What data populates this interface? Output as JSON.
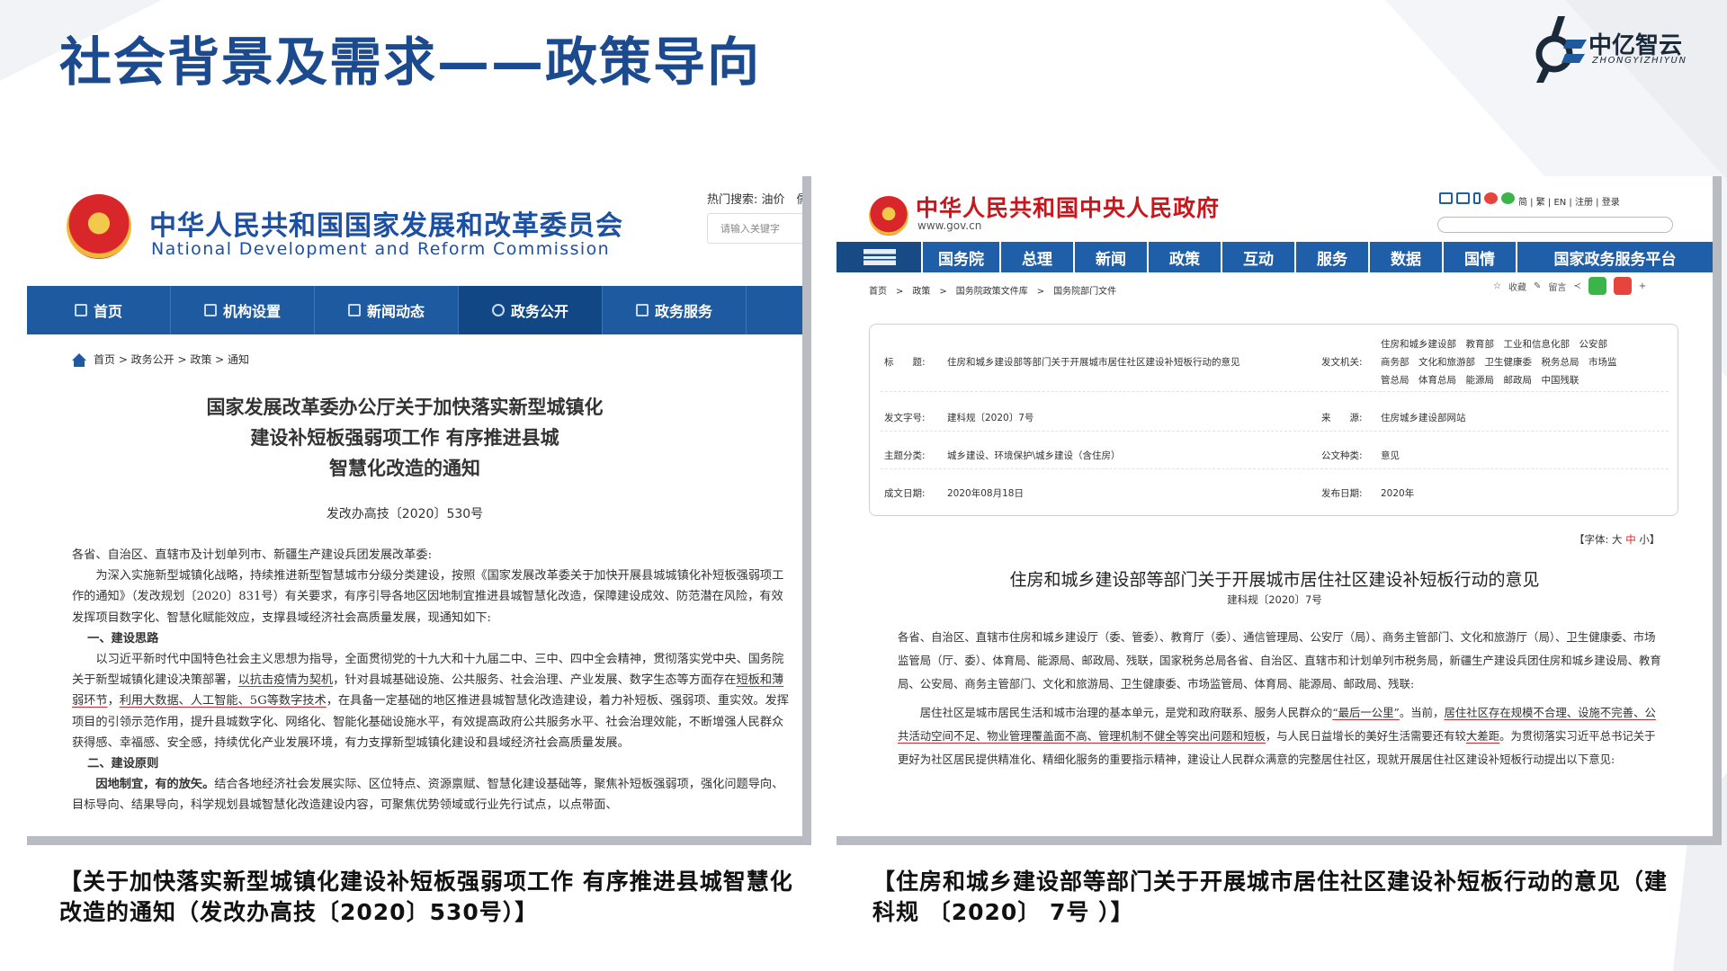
{
  "slide": {
    "title": "社会背景及需求——政策导向",
    "logo": {
      "cn": "中亿智云",
      "en": "ZHONGYIZHIYUN"
    }
  },
  "left_doc": {
    "site_name_cn": "中华人民共和国国家发展和改革委员会",
    "site_name_en": "National Development and Reform Commission",
    "hot_search": "热门搜索: 油价　儒",
    "search_placeholder": "请输入关键字",
    "nav": [
      "首页",
      "机构设置",
      "新闻动态",
      "政务公开",
      "政务服务"
    ],
    "breadcrumb": "首页 > 政务公开 > 政策 > 通知",
    "title_lines": [
      "国家发展改革委办公厅关于加快落实新型城镇化",
      "建设补短板强弱项工作 有序推进县城",
      "智慧化改造的通知"
    ],
    "doc_number": "发改办高技〔2020〕530号",
    "salutation": "各省、自治区、直辖市及计划单列市、新疆生产建设兵团发展改革委:",
    "para1": "为深入实施新型城镇化战略，持续推进新型智慧城市分级分类建设，按照《国家发展改革委关于加快开展县城城镇化补短板强弱项工作的通知》（发改规划〔2020〕831号）有关要求，有序引导各地区因地制宜推进县城智慧化改造，保障建设成效、防范潜在风险，有效发挥项目数字化、智慧化赋能效应，支撑县域经济社会高质量发展，现通知如下:",
    "heading1": "一、建设思路",
    "para2_a": "以习近平新时代中国特色社会主义思想为指导，全面贯彻党的十九大和十九届二中、三中、四中全会精神，贯彻落实党中央、国务院关于新型城镇化建设决策部署，",
    "para2_u1": "以抗击疫情为契机",
    "para2_b": "，针对县城基础设施、公共服务、社会治理、产业发展、数字生态等方面存在",
    "para2_u2": "短板和薄弱环节",
    "para2_c": "，",
    "para2_u3": "利用大数据、人工智能、5G等数字技术",
    "para2_d": "，在具备一定基础的地区推进县城智慧化改造建设，着力补短板、强弱项、重实效。发挥项目的引领示范作用，提升县城数字化、网络化、智能化基础设施水平，有效提高政府公共服务水平、社会治理效能，不断增强人民群众获得感、幸福感、安全感，持续优化产业发展环境，有力支撑新型城镇化建设和县域经济社会高质量发展。",
    "heading2": "二、建设原则",
    "principle_bold": "因地制宜，有的放矢。",
    "principle_text": "结合各地经济社会发展实际、区位特点、资源禀赋、智慧化建设基础等，聚焦补短板强弱项，强化问题导向、目标导向、结果导向，科学规划县城智慧化改造建设内容，可聚焦优势领域或行业先行试点，以点带面、"
  },
  "right_doc": {
    "site_name": "中华人民共和国中央人民政府",
    "url": "www.gov.cn",
    "links": "简 | 繁 | EN | 注册 | 登录",
    "nav": [
      "国务院",
      "总理",
      "新闻",
      "政策",
      "互动",
      "服务",
      "数据",
      "国情",
      "国家政务服务平台"
    ],
    "breadcrumb": "首页　>　政策　>　国务院政策文件库　>　国务院部门文件",
    "tools": [
      "收藏",
      "留言"
    ],
    "meta": {
      "title_label": "标　　题:",
      "title_value": "住房和城乡建设部等部门关于开展城市居住社区建设补短板行动的意见",
      "issuer_label": "发文机关:",
      "issuer_lines": [
        "住房和城乡建设部　教育部　工业和信息化部　公安部",
        "商务部　文化和旅游部　卫生健康委　税务总局　市场监",
        "管总局　体育总局　能源局　邮政局　中国残联"
      ],
      "doc_no_label": "发文字号:",
      "doc_no_value": "建科规〔2020〕7号",
      "source_label": "来　　源:",
      "source_value": "住房城乡建设部网站",
      "topic_label": "主题分类:",
      "topic_value": "城乡建设、环境保护\\城乡建设（含住房）",
      "type_label": "公文种类:",
      "type_value": "意见",
      "date_label": "成文日期:",
      "date_value": "2020年08月18日",
      "pub_label": "发布日期:",
      "pub_value": "2020年"
    },
    "font_size": {
      "prefix": "【字体:",
      "large": "大",
      "medium": "中",
      "small": "小",
      "suffix": "】"
    },
    "title": "住房和城乡建设部等部门关于开展城市居住社区建设补短板行动的意见",
    "doc_number": "建科规〔2020〕7号",
    "para1": "各省、自治区、直辖市住房和城乡建设厅（委、管委）、教育厅（委）、通信管理局、公安厅（局）、商务主管部门、文化和旅游厅（局）、卫生健康委、市场监管局（厅、委）、体育局、能源局、邮政局、残联，国家税务总局各省、自治区、直辖市和计划单列市税务局，新疆生产建设兵团住房和城乡建设局、教育局、公安局、商务主管部门、文化和旅游局、卫生健康委、市场监管局、体育局、能源局、邮政局、残联:",
    "para2_a": "居住社区是城市居民生活和城市治理的基本单元，是党和政府联系、服务人民群众的",
    "para2_u1": "“最后一公里”",
    "para2_b": "。当前，",
    "para2_u2": "居住社区存在规模不合理、设施不完善、公共活动空间不足、物业管理覆盖面不高、管理机制不健全等突出问题和短板",
    "para2_c": "，与人民日益增长的美好生活需要还有较",
    "para2_u3": "大差距",
    "para2_d": "。为贯彻落实习近平总书记关于更好为社区居民提供精准化、精细化服务的重要指示精神，建设让人民群众满意的完整居住社区，现就开展居住社区建设补短板行动提出以下意见:"
  },
  "captions": {
    "left": "【关于加快落实新型城镇化建设补短板强弱项工作 有序推进县城智慧化改造的通知（发改办高技〔2020〕530号）】",
    "right": "【住房和城乡建设部等部门关于开展城市居住社区建设补短板行动的意见（建科规 〔2020〕 7号 ）】"
  },
  "colors": {
    "title_blue": "#1c4a8e",
    "ndrc_blue": "#1e5aa0",
    "gov_red": "#c8161d",
    "gov_blue": "#1f5ea8",
    "underline_red": "#d0282c"
  }
}
